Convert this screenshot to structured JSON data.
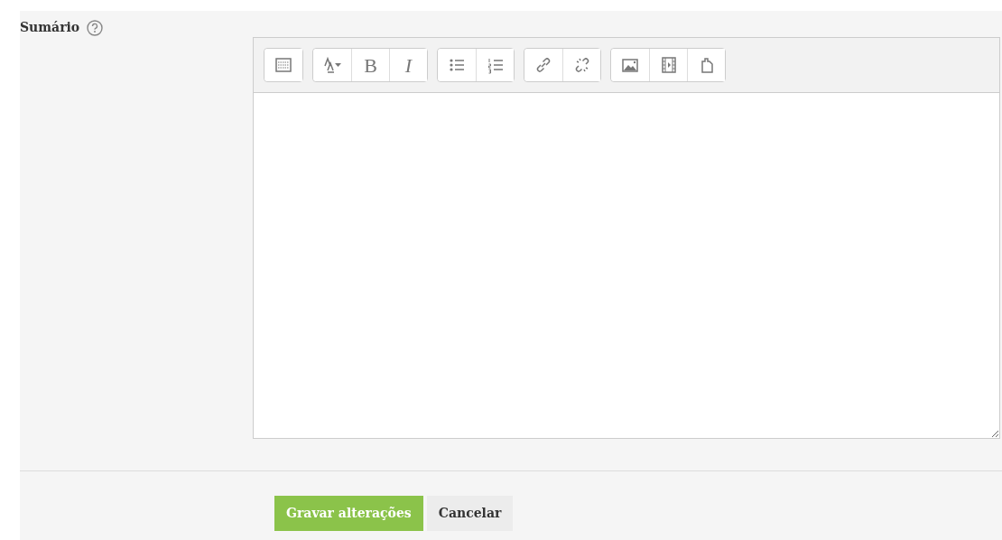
{
  "field": {
    "label": "Sumário"
  },
  "toolbar": [
    {
      "buttons": [
        {
          "kind": "toggle"
        }
      ]
    },
    {
      "buttons": [
        {
          "kind": "style"
        },
        {
          "kind": "bold",
          "text": "B"
        },
        {
          "kind": "italic",
          "text": "I"
        }
      ]
    },
    {
      "buttons": [
        {
          "kind": "bullets"
        },
        {
          "kind": "numbers"
        }
      ]
    },
    {
      "buttons": [
        {
          "kind": "link"
        },
        {
          "kind": "unlink"
        }
      ]
    },
    {
      "buttons": [
        {
          "kind": "image"
        },
        {
          "kind": "video"
        },
        {
          "kind": "file"
        }
      ]
    }
  ],
  "actions": [
    {
      "label": "Gravar alterações",
      "kind": "primary"
    },
    {
      "label": "Cancelar",
      "kind": "secondary"
    }
  ]
}
